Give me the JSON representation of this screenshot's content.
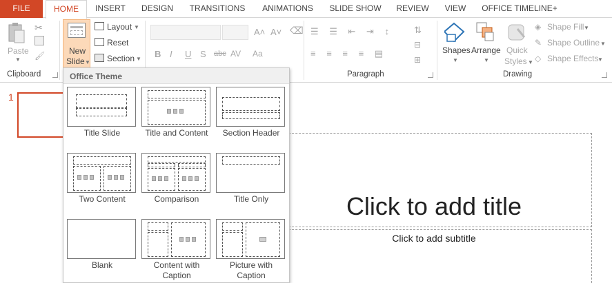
{
  "tabs": [
    "FILE",
    "HOME",
    "INSERT",
    "DESIGN",
    "TRANSITIONS",
    "ANIMATIONS",
    "SLIDE SHOW",
    "REVIEW",
    "VIEW",
    "OFFICE TIMELINE+"
  ],
  "clipboard": {
    "paste": "Paste",
    "group": "Clipboard"
  },
  "slides_group": {
    "new_slide_line1": "New",
    "new_slide_line2": "Slide",
    "layout": "Layout",
    "reset": "Reset",
    "section": "Section"
  },
  "font_group": {
    "bold": "B",
    "italic": "I",
    "underline": "U",
    "shadow": "S",
    "strike": "abc",
    "spacing": "AV",
    "case": "Aa"
  },
  "paragraph_group": {
    "group": "Paragraph"
  },
  "drawing_group": {
    "shapes": "Shapes",
    "arrange": "Arrange",
    "quick_styles_line1": "Quick",
    "quick_styles_line2": "Styles",
    "shape_fill": "Shape Fill",
    "shape_outline": "Shape Outline",
    "shape_effects": "Shape Effects",
    "group": "Drawing"
  },
  "slide_panel": {
    "slide_number": "1"
  },
  "slide": {
    "title_placeholder": "Click to add title",
    "subtitle_placeholder": "Click to add subtitle"
  },
  "gallery": {
    "heading": "Office Theme",
    "layouts": [
      "Title Slide",
      "Title and Content",
      "Section Header",
      "Two Content",
      "Comparison",
      "Title Only",
      "Blank",
      "Content with\nCaption",
      "Picture with\nCaption"
    ]
  },
  "colors": {
    "accent": "#d24726"
  }
}
